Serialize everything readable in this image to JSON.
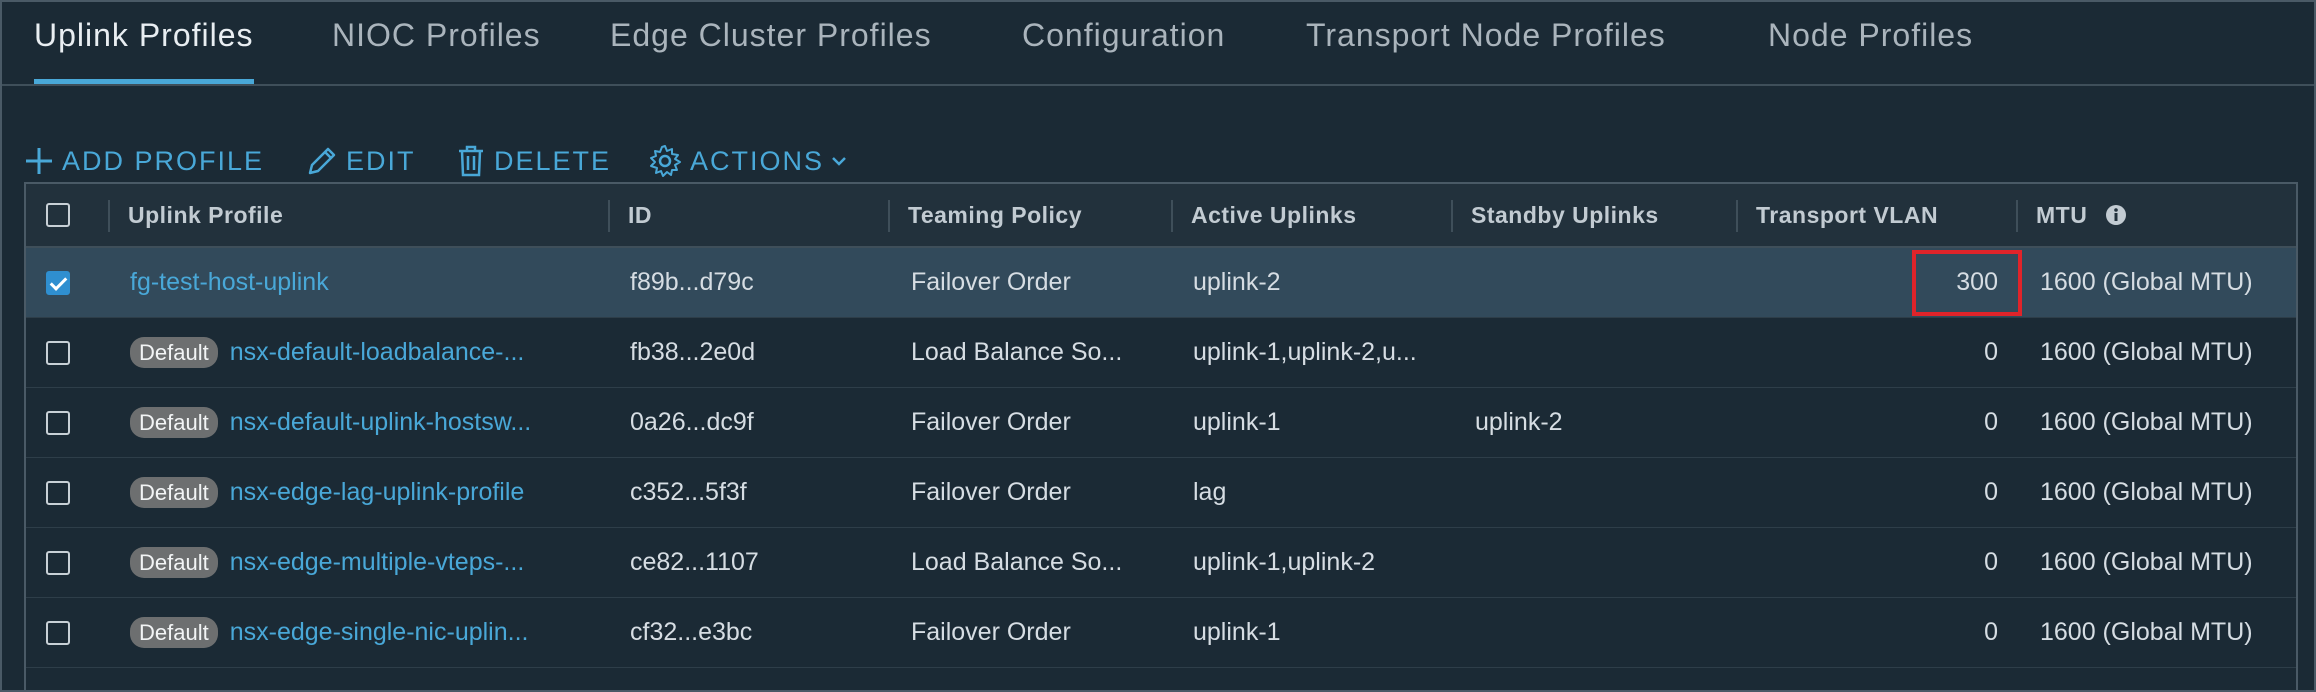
{
  "tabs": [
    {
      "label": "Uplink Profiles",
      "active": true
    },
    {
      "label": "NIOC Profiles"
    },
    {
      "label": "Edge Cluster Profiles"
    },
    {
      "label": "Configuration"
    },
    {
      "label": "Transport Node Profiles"
    },
    {
      "label": "Node Profiles"
    }
  ],
  "toolbar": {
    "add_label": "ADD PROFILE",
    "edit_label": "EDIT",
    "delete_label": "DELETE",
    "actions_label": "ACTIONS"
  },
  "columns": [
    "Uplink Profile",
    "ID",
    "Teaming Policy",
    "Active Uplinks",
    "Standby Uplinks",
    "Transport VLAN",
    "MTU"
  ],
  "badge_label": "Default",
  "rows": [
    {
      "selected": true,
      "default": false,
      "name": "fg-test-host-uplink",
      "id": "f89b...d79c",
      "teaming": "Failover Order",
      "active": "uplink-2",
      "standby": "",
      "vlan": "300",
      "mtu": "1600 (Global MTU)"
    },
    {
      "selected": false,
      "default": true,
      "name": "nsx-default-loadbalance-...",
      "id": "fb38...2e0d",
      "teaming": "Load Balance So...",
      "active": "uplink-1,uplink-2,u...",
      "standby": "",
      "vlan": "0",
      "mtu": "1600 (Global MTU)"
    },
    {
      "selected": false,
      "default": true,
      "name": "nsx-default-uplink-hostsw...",
      "id": "0a26...dc9f",
      "teaming": "Failover Order",
      "active": "uplink-1",
      "standby": "uplink-2",
      "vlan": "0",
      "mtu": "1600 (Global MTU)"
    },
    {
      "selected": false,
      "default": true,
      "name": "nsx-edge-lag-uplink-profile",
      "id": "c352...5f3f",
      "teaming": "Failover Order",
      "active": "lag",
      "standby": "",
      "vlan": "0",
      "mtu": "1600 (Global MTU)"
    },
    {
      "selected": false,
      "default": true,
      "name": "nsx-edge-multiple-vteps-...",
      "id": "ce82...1107",
      "teaming": "Load Balance So...",
      "active": "uplink-1,uplink-2",
      "standby": "",
      "vlan": "0",
      "mtu": "1600 (Global MTU)"
    },
    {
      "selected": false,
      "default": true,
      "name": "nsx-edge-single-nic-uplin...",
      "id": "cf32...e3bc",
      "teaming": "Failover Order",
      "active": "uplink-1",
      "standby": "",
      "vlan": "0",
      "mtu": "1600 (Global MTU)"
    }
  ],
  "colors": {
    "accent": "#49a8d8",
    "background": "#1b2a35",
    "selected_row": "#324a5b",
    "highlight": "#e0242a"
  },
  "icons": {
    "add": "plus-icon",
    "edit": "pencil-icon",
    "delete": "trash-icon",
    "actions": "gear-icon",
    "actions_menu": "chevron-down-icon",
    "mtu_info": "info-icon"
  }
}
